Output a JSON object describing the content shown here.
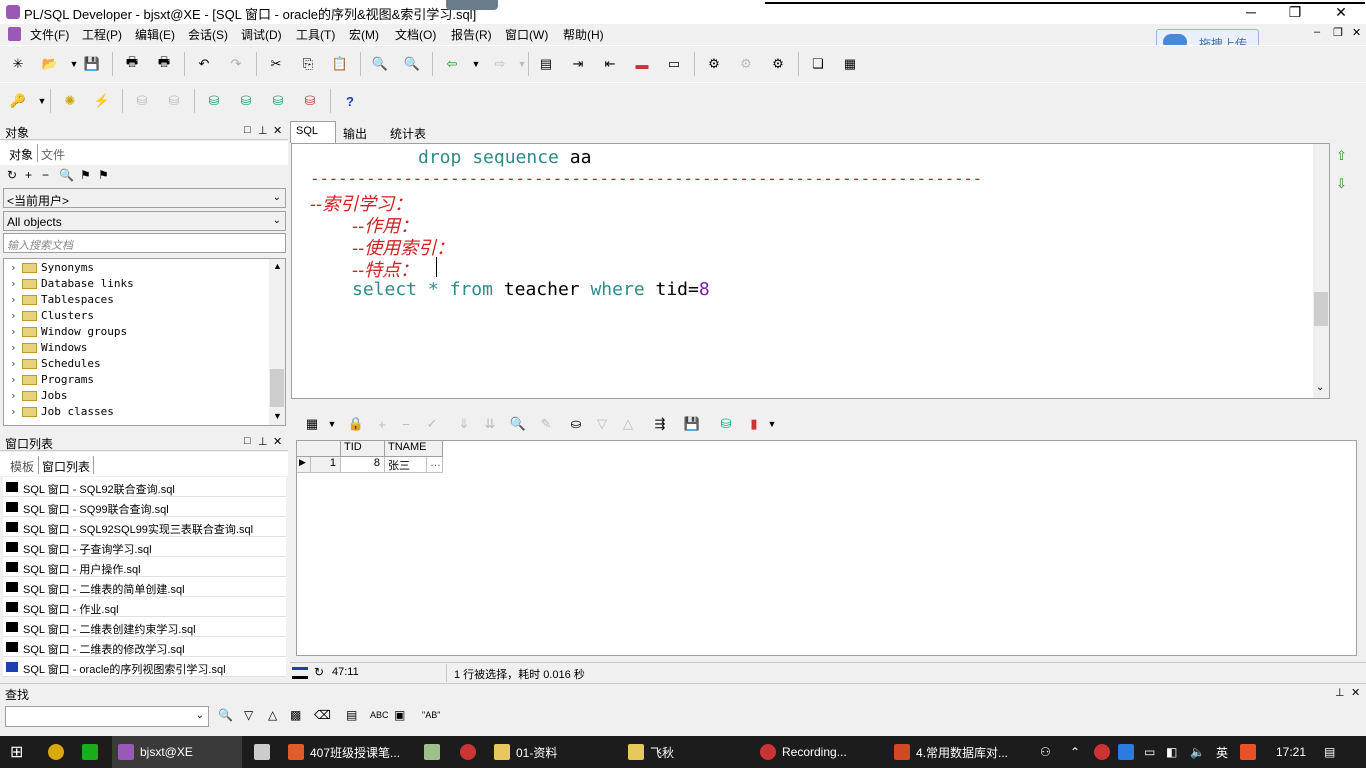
{
  "window": {
    "title": "PL/SQL Developer - bjsxt@XE - [SQL 窗口 - oracle的序列&视图&索引学习.sql]"
  },
  "menu": [
    "文件(F)",
    "工程(P)",
    "编辑(E)",
    "会话(S)",
    "调试(D)",
    "工具(T)",
    "宏(M)",
    "文档(O)",
    "报告(R)",
    "窗口(W)",
    "帮助(H)"
  ],
  "upload_button": "拖拽上传",
  "objects_panel": {
    "title": "对象",
    "tabs": [
      "对象",
      "文件"
    ],
    "user_combo": "<当前用户>",
    "filter_combo": "All objects",
    "search_placeholder": "输入搜索文档",
    "tree": [
      "Synonyms",
      "Database links",
      "Tablespaces",
      "Clusters",
      "Window groups",
      "Windows",
      "Schedules",
      "Programs",
      "Jobs",
      "Job classes"
    ]
  },
  "window_list_panel": {
    "title": "窗口列表",
    "tabs": [
      "模板",
      "窗口列表"
    ],
    "items": [
      "SQL 窗口 - SQL92联合查询.sql",
      "SQL 窗口 - SQ99联合查询.sql",
      "SQL 窗口 - SQL92SQL99实现三表联合查询.sql",
      "SQL 窗口 - 子查询学习.sql",
      "SQL 窗口 - 用户操作.sql",
      "SQL 窗口 - 二维表的简单创建.sql",
      "SQL 窗口 - 作业.sql",
      "SQL 窗口 - 二维表创建约束学习.sql",
      "SQL 窗口 - 二维表的修改学习.sql",
      "SQL 窗口 - oracle的序列视图索引学习.sql"
    ]
  },
  "editor_tabs": [
    "SQL",
    "输出",
    "统计表"
  ],
  "editor": {
    "line1_kw1": "drop",
    "line1_kw2": "sequence",
    "line1_id": "aa",
    "separator": "------------------------------------------------------------------------",
    "comment_title": "--索引学习：",
    "comment_1": "--作用：",
    "comment_2": "--使用索引：",
    "comment_3": "--特点：",
    "sql_select": "select",
    "sql_star": "*",
    "sql_from": "from",
    "sql_table": "teacher",
    "sql_where": "where",
    "sql_cond": "tid=",
    "sql_val": "8"
  },
  "grid": {
    "columns": [
      "TID",
      "TNAME"
    ],
    "rows": [
      {
        "num": "1",
        "tid": "8",
        "tname": "张三",
        "more": "…"
      }
    ]
  },
  "status": {
    "position": "47:11",
    "message": "1 行被选择，耗时 0.016 秒"
  },
  "find_panel": {
    "title": "查找",
    "abc": "ABC",
    "quoted": "\"AB\""
  },
  "taskbar": {
    "items": [
      "bjsxt@XE",
      "407班级授课笔...",
      "01-资料",
      "飞秋",
      "Recording...",
      "4.常用数据库对..."
    ],
    "lang": "英",
    "time": "17:21"
  }
}
